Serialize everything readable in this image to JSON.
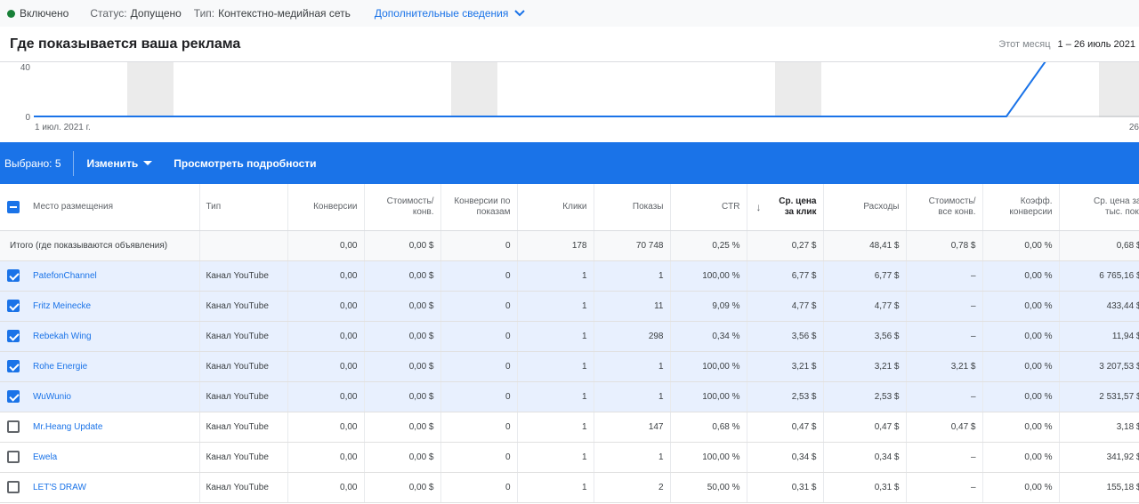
{
  "status": {
    "state": "Включено",
    "status_label": "Статус:",
    "status_value": "Допущено",
    "type_label": "Тип:",
    "type_value": "Контекстно-медийная сеть",
    "details_link": "Дополнительные сведения"
  },
  "header": {
    "title": "Где показывается ваша реклама",
    "period_label": "Этот месяц",
    "period_range": "1 – 26 июль 2021"
  },
  "chart_data": {
    "type": "line",
    "y_ticks": [
      "40",
      "0"
    ],
    "x_start_label": "1 июл. 2021 г.",
    "x_end_label": "26",
    "series": [
      {
        "color": "#1a73e8",
        "points": [
          [
            1,
            0
          ],
          [
            23,
            0
          ],
          [
            24,
            50
          ]
        ]
      }
    ]
  },
  "toolbar": {
    "selected": "Выбрано: 5",
    "edit": "Изменить",
    "view_details": "Просмотреть подробности"
  },
  "table": {
    "headers": {
      "placement": "Место размещения",
      "type": "Тип",
      "conversions": "Конверсии",
      "cost_conv_1": "Стоимость/",
      "cost_conv_2": "конв.",
      "view_conv_1": "Конверсии по",
      "view_conv_2": "показам",
      "clicks": "Клики",
      "impressions": "Показы",
      "ctr": "CTR",
      "avg_cpc_1": "Ср. цена",
      "avg_cpc_2": "за клик",
      "cost": "Расходы",
      "cost_all_conv_1": "Стоимость/",
      "cost_all_conv_2": "все конв.",
      "conv_rate_1": "Коэфф.",
      "conv_rate_2": "конверсии",
      "cpm_1": "Ср. цена за",
      "cpm_2": "тыс. пок."
    },
    "total": {
      "label": "Итого (где показываются объявления)",
      "conversions": "0,00",
      "cost_conv": "0,00 $",
      "view_conv": "0",
      "clicks": "178",
      "impressions": "70 748",
      "ctr": "0,25 %",
      "avg_cpc": "0,27 $",
      "cost": "48,41 $",
      "cost_all_conv": "0,78 $",
      "conv_rate": "0,00 %",
      "cpm": "0,68 $"
    },
    "rows": [
      {
        "name": "PatefonChannel",
        "type": "Канал YouTube",
        "conversions": "0,00",
        "cost_conv": "0,00 $",
        "view_conv": "0",
        "clicks": "1",
        "impressions": "1",
        "ctr": "100,00 %",
        "avg_cpc": "6,77 $",
        "cost": "6,77 $",
        "cost_all_conv": "–",
        "conv_rate": "0,00 %",
        "cpm": "6 765,16 $",
        "checked": true
      },
      {
        "name": "Fritz Meinecke",
        "type": "Канал YouTube",
        "conversions": "0,00",
        "cost_conv": "0,00 $",
        "view_conv": "0",
        "clicks": "1",
        "impressions": "11",
        "ctr": "9,09 %",
        "avg_cpc": "4,77 $",
        "cost": "4,77 $",
        "cost_all_conv": "–",
        "conv_rate": "0,00 %",
        "cpm": "433,44 $",
        "checked": true
      },
      {
        "name": "Rebekah Wing",
        "type": "Канал YouTube",
        "conversions": "0,00",
        "cost_conv": "0,00 $",
        "view_conv": "0",
        "clicks": "1",
        "impressions": "298",
        "ctr": "0,34 %",
        "avg_cpc": "3,56 $",
        "cost": "3,56 $",
        "cost_all_conv": "–",
        "conv_rate": "0,00 %",
        "cpm": "11,94 $",
        "checked": true
      },
      {
        "name": "Rohe Energie",
        "type": "Канал YouTube",
        "conversions": "0,00",
        "cost_conv": "0,00 $",
        "view_conv": "0",
        "clicks": "1",
        "impressions": "1",
        "ctr": "100,00 %",
        "avg_cpc": "3,21 $",
        "cost": "3,21 $",
        "cost_all_conv": "3,21 $",
        "conv_rate": "0,00 %",
        "cpm": "3 207,53 $",
        "checked": true
      },
      {
        "name": "WuWunio",
        "type": "Канал YouTube",
        "conversions": "0,00",
        "cost_conv": "0,00 $",
        "view_conv": "0",
        "clicks": "1",
        "impressions": "1",
        "ctr": "100,00 %",
        "avg_cpc": "2,53 $",
        "cost": "2,53 $",
        "cost_all_conv": "–",
        "conv_rate": "0,00 %",
        "cpm": "2 531,57 $",
        "checked": true
      },
      {
        "name": "Mr.Heang Update",
        "type": "Канал YouTube",
        "conversions": "0,00",
        "cost_conv": "0,00 $",
        "view_conv": "0",
        "clicks": "1",
        "impressions": "147",
        "ctr": "0,68 %",
        "avg_cpc": "0,47 $",
        "cost": "0,47 $",
        "cost_all_conv": "0,47 $",
        "conv_rate": "0,00 %",
        "cpm": "3,18 $",
        "checked": false
      },
      {
        "name": "Ewela",
        "type": "Канал YouTube",
        "conversions": "0,00",
        "cost_conv": "0,00 $",
        "view_conv": "0",
        "clicks": "1",
        "impressions": "1",
        "ctr": "100,00 %",
        "avg_cpc": "0,34 $",
        "cost": "0,34 $",
        "cost_all_conv": "–",
        "conv_rate": "0,00 %",
        "cpm": "341,92 $",
        "checked": false
      },
      {
        "name": "LET'S DRAW",
        "type": "Канал YouTube",
        "conversions": "0,00",
        "cost_conv": "0,00 $",
        "view_conv": "0",
        "clicks": "1",
        "impressions": "2",
        "ctr": "50,00 %",
        "avg_cpc": "0,31 $",
        "cost": "0,31 $",
        "cost_all_conv": "–",
        "conv_rate": "0,00 %",
        "cpm": "155,18 $",
        "checked": false
      }
    ]
  }
}
